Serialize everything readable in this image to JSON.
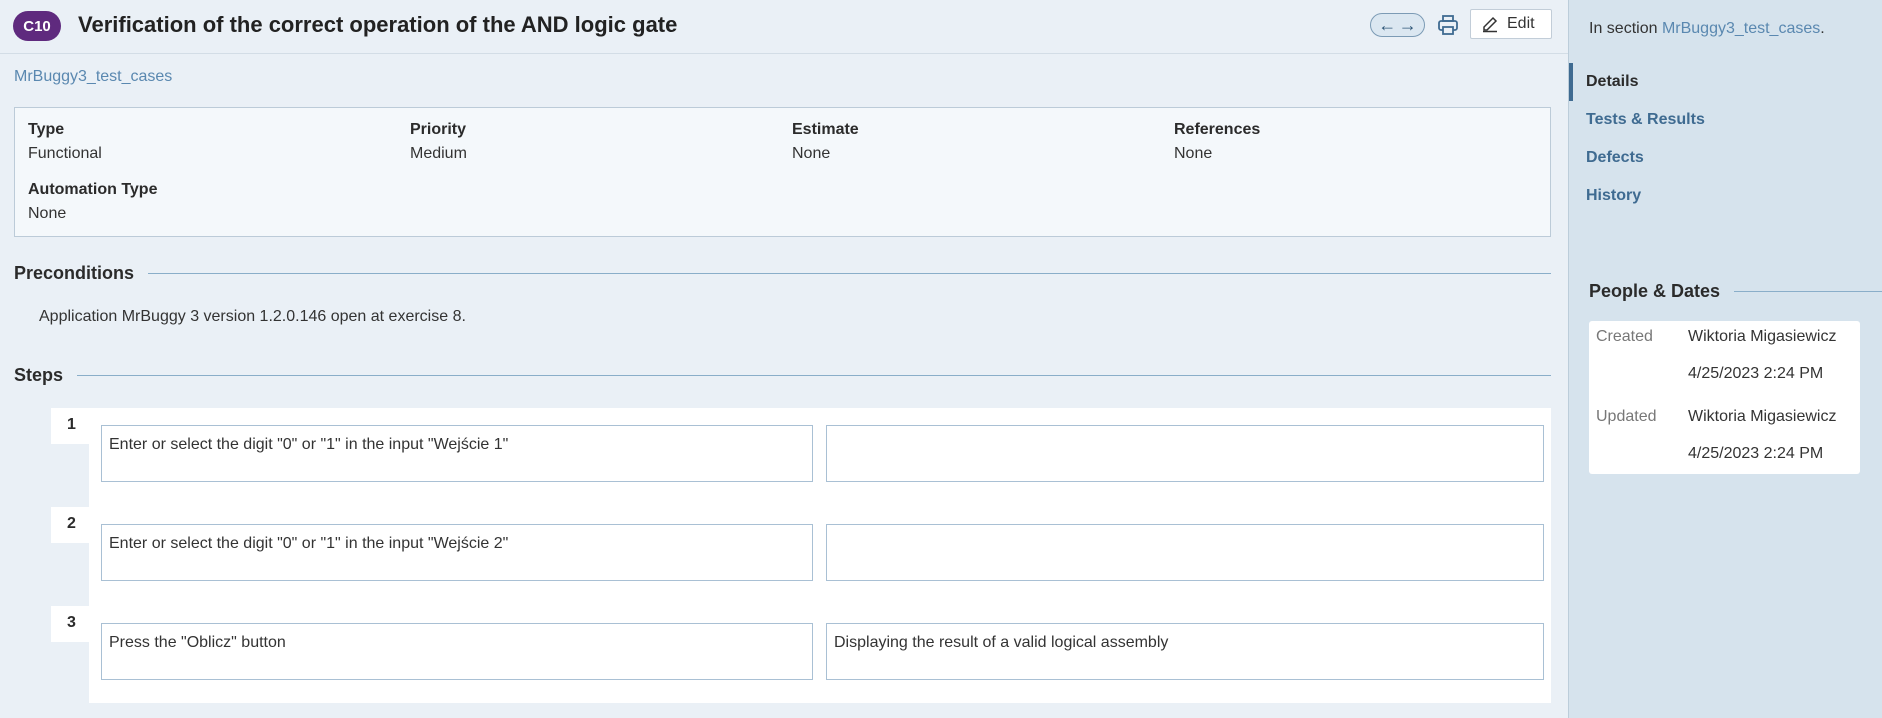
{
  "header": {
    "case_id": "C10",
    "title": "Verification of the correct operation of the AND logic gate",
    "edit_label": "Edit"
  },
  "breadcrumb": "MrBuggy3_test_cases",
  "properties": {
    "type": {
      "label": "Type",
      "value": "Functional"
    },
    "priority": {
      "label": "Priority",
      "value": "Medium"
    },
    "estimate": {
      "label": "Estimate",
      "value": "None"
    },
    "references": {
      "label": "References",
      "value": "None"
    },
    "automation_type": {
      "label": "Automation Type",
      "value": "None"
    }
  },
  "preconditions": {
    "heading": "Preconditions",
    "text": "Application MrBuggy 3 version 1.2.0.146 open at exercise 8."
  },
  "steps": {
    "heading": "Steps",
    "items": [
      {
        "number": "1",
        "content": "Enter or select the digit \"0\" or \"1\" in the input \"Wejście 1\"",
        "expected": ""
      },
      {
        "number": "2",
        "content": "Enter or select the digit \"0\" or \"1\" in the input \"Wejście 2\"",
        "expected": ""
      },
      {
        "number": "3",
        "content": "Press the \"Oblicz\" button",
        "expected": "Displaying the result of a valid logical assembly"
      }
    ]
  },
  "sidebar": {
    "in_section_prefix": "In section ",
    "in_section_link": "MrBuggy3_test_cases",
    "in_section_suffix": ".",
    "nav": [
      {
        "label": "Details",
        "active": true
      },
      {
        "label": "Tests & Results",
        "active": false
      },
      {
        "label": "Defects",
        "active": false
      },
      {
        "label": "History",
        "active": false
      }
    ],
    "people_heading": "People & Dates",
    "created_label": "Created",
    "created_by": "Wiktoria Migasiewicz",
    "created_date": "4/25/2023 2:24 PM",
    "updated_label": "Updated",
    "updated_by": "Wiktoria Migasiewicz",
    "updated_date": "4/25/2023 2:24 PM"
  },
  "colors": {
    "badge": "#5f2a7e",
    "link": "#5a88b0",
    "sidebar_bg": "#d6e3ed"
  },
  "icons": [
    "arrow-left-icon",
    "arrow-right-icon",
    "printer-icon",
    "pencil-icon"
  ]
}
